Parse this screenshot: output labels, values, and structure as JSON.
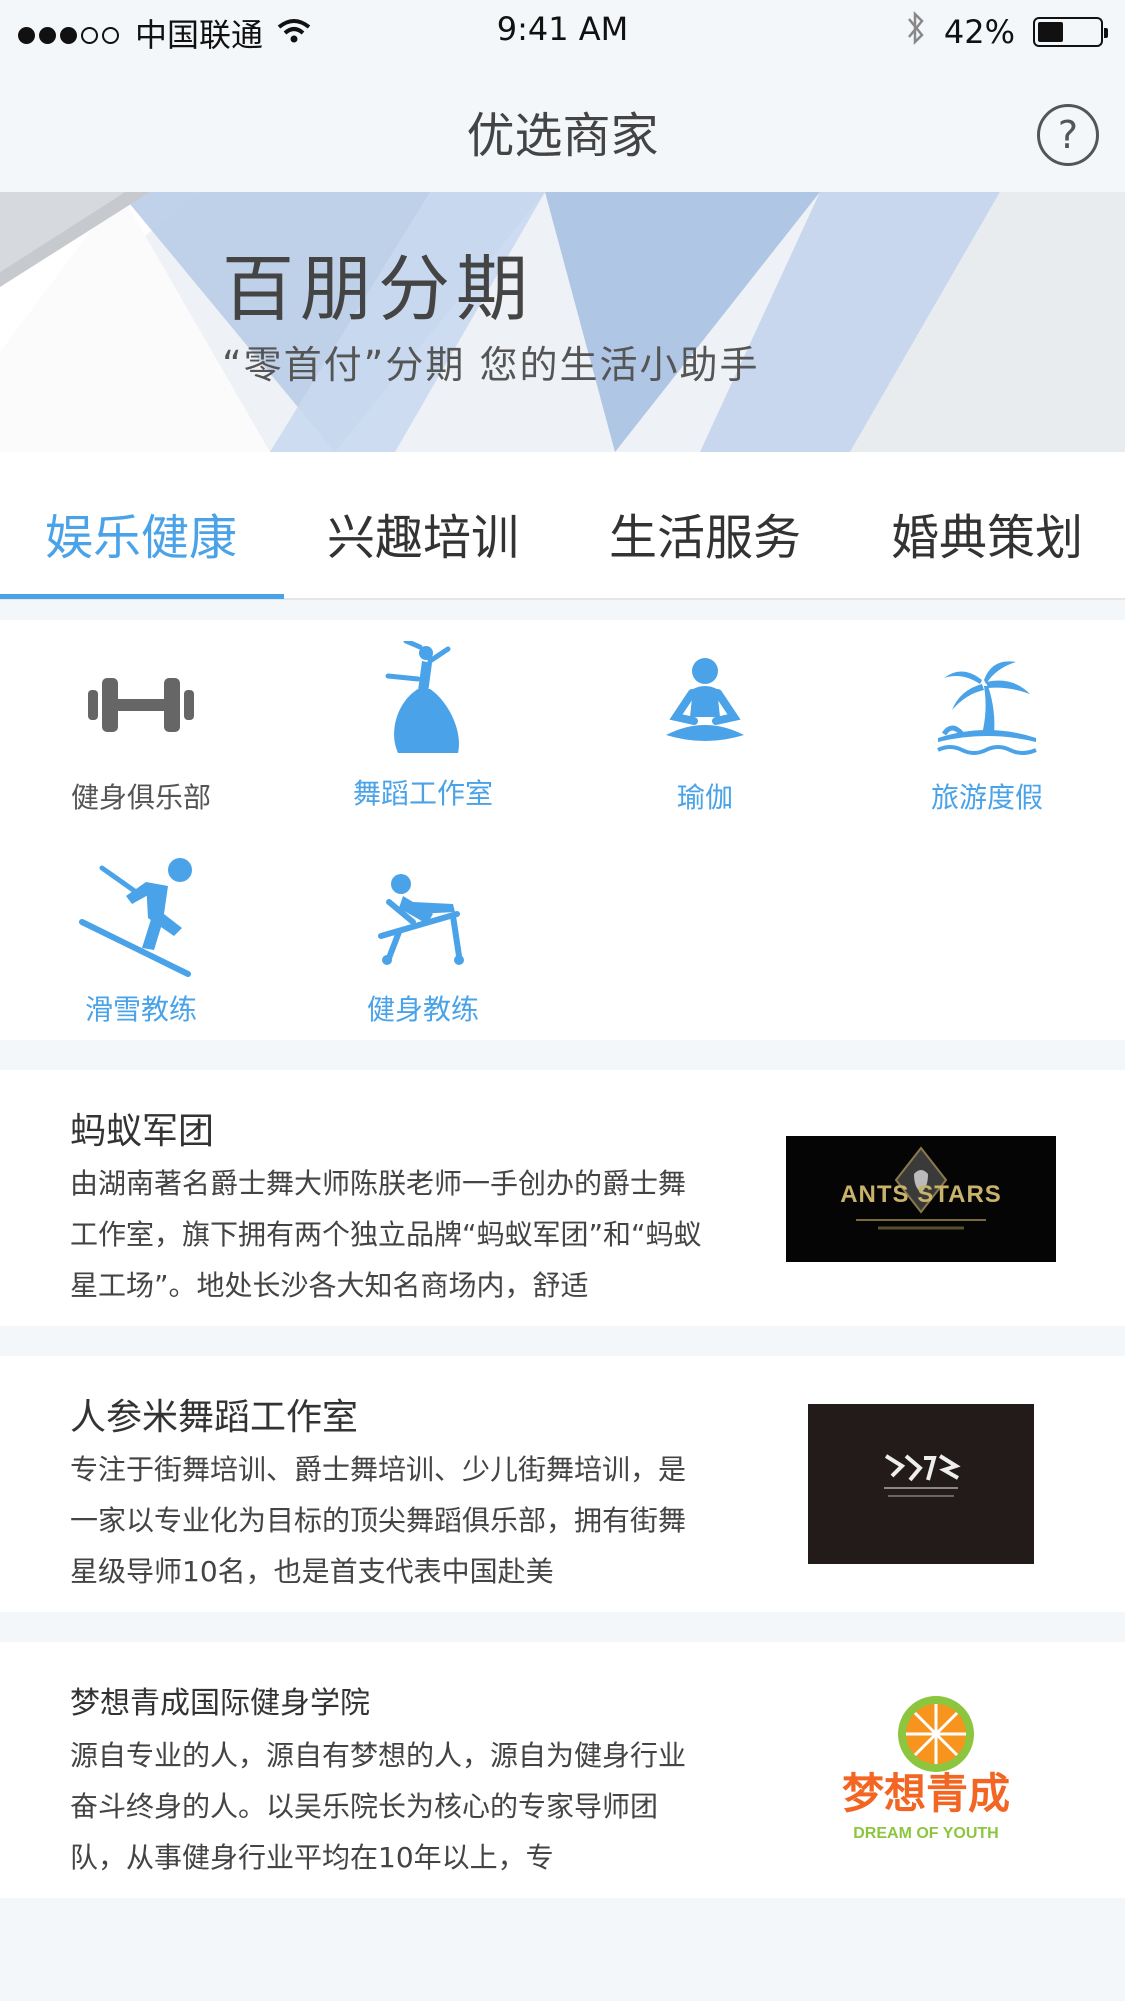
{
  "status_bar": {
    "carrier": "中国联通",
    "time": "9:41 AM",
    "battery": "42%",
    "battery_level": 0.42
  },
  "nav": {
    "title": "优选商家",
    "help": "?"
  },
  "banner": {
    "headline": "百朋分期",
    "subtitle": "“零首付”分期  您的生活小助手"
  },
  "tabs": [
    {
      "label": "娱乐健康"
    },
    {
      "label": "兴趣培训"
    },
    {
      "label": "生活服务"
    },
    {
      "label": "婚典策划"
    }
  ],
  "categories": [
    {
      "label": "健身俱乐部",
      "icon": "dumbbell-icon"
    },
    {
      "label": "舞蹈工作室",
      "icon": "dancer-icon"
    },
    {
      "label": "瑜伽",
      "icon": "yoga-icon"
    },
    {
      "label": "旅游度假",
      "icon": "palm-island-icon"
    },
    {
      "label": "滑雪教练",
      "icon": "skier-icon"
    },
    {
      "label": "健身教练",
      "icon": "bench-press-icon"
    }
  ],
  "merchants": [
    {
      "name": "蚂蚁军团",
      "description": "由湖南著名爵士舞大师陈朕老师一手创办的爵士舞工作室，旗下拥有两个独立品牌“蚂蚁军团”和“蚂蚁星工场”。地处长沙各大知名商场内，舒适",
      "logo_text": "ANTS STARS"
    },
    {
      "name": "人参米舞蹈工作室",
      "description": "专注于街舞培训、爵士舞培训、少儿街舞培训，是一家以专业化为目标的顶尖舞蹈俱乐部，拥有街舞星级导师10名，也是首支代表中国赴美"
    },
    {
      "name": "梦想青成国际健身学院",
      "description": "源自专业的人，源自有梦想的人，源自为健身行业奋斗终身的人。以吴乐院长为核心的专家导师团队，从事健身行业平均在10年以上，专",
      "logo_text": "梦想青成",
      "logo_subtext": "DREAM OF YOUTH"
    }
  ],
  "colors": {
    "accent": "#4aa3e8",
    "background": "#f3f7fa"
  }
}
